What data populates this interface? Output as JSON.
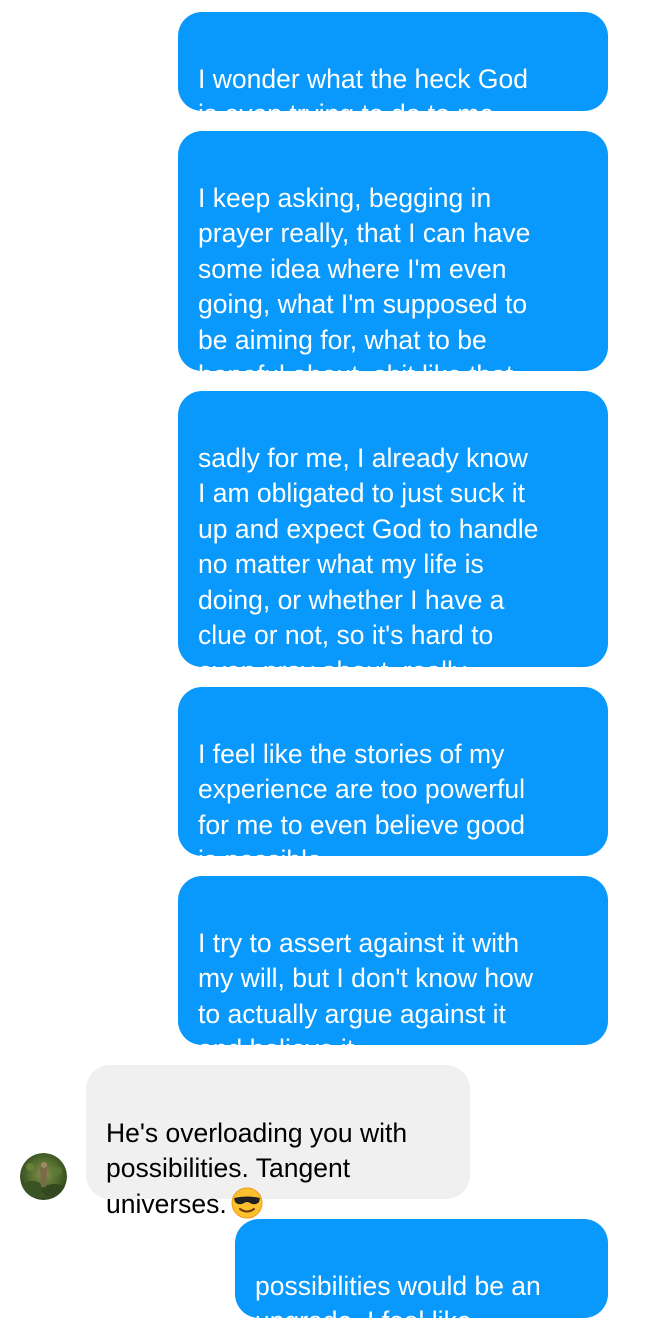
{
  "messages": [
    {
      "direction": "sent",
      "text": "I wonder what the heck God\nis even trying to do to me"
    },
    {
      "direction": "sent",
      "text": "I keep asking, begging in\nprayer really, that I can have\nsome idea where I'm even\ngoing, what I'm supposed to\nbe aiming for, what to be\nhopeful about, shit like that"
    },
    {
      "direction": "sent",
      "text": "sadly for me, I already know\nI am obligated to just suck it\nup and expect God to handle\nno matter what my life is\ndoing, or whether I have a\nclue or not, so it's hard to\neven pray about, really"
    },
    {
      "direction": "sent",
      "text": "I feel like the stories of my\nexperience are too powerful\nfor me to even believe good\nis possible"
    },
    {
      "direction": "sent",
      "text": "I try to assert against it with\nmy will, but I don't know how\nto actually argue against it\nand believe it"
    },
    {
      "direction": "received",
      "text": "He's overloading you with\npossibilities. Tangent\nuniverses.",
      "emoji": "smiling-face-with-sunglasses"
    },
    {
      "direction": "sent",
      "text": "possibilities would be an\nupgrade, I feel like"
    }
  ],
  "colors": {
    "sent_bubble": "#0998fb",
    "sent_text": "#ffffff",
    "received_bubble": "#f0f0f0",
    "received_text": "#000000"
  }
}
